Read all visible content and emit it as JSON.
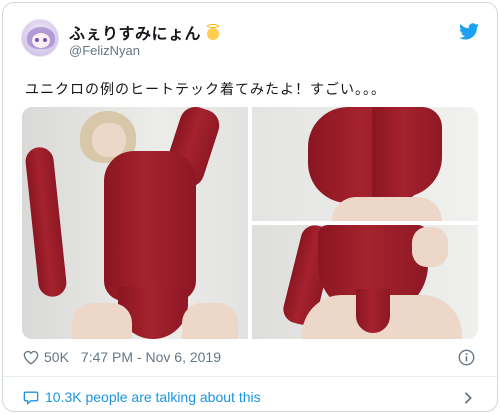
{
  "user": {
    "display_name": "ふぇりすみにょん",
    "handle": "@FelizNyan",
    "badge_emoji": "angel-emoji"
  },
  "tweet": {
    "text": "ユニクロの例のヒートテック着てみたよ！すごい。。。"
  },
  "media": {
    "photo_count": 3
  },
  "footer": {
    "likes": "50K",
    "timestamp": "7:47 PM - Nov 6, 2019",
    "talking": "10.3K people are talking about this"
  },
  "icons": {
    "brand": "twitter-bird-icon",
    "like": "heart-icon",
    "info": "info-icon",
    "reply": "speech-bubble-icon",
    "more": "chevron-right-icon"
  },
  "colors": {
    "accent": "#1da1f2",
    "link": "#1b95e0",
    "muted": "#657786",
    "bodysuit": "#9b1f2b"
  }
}
